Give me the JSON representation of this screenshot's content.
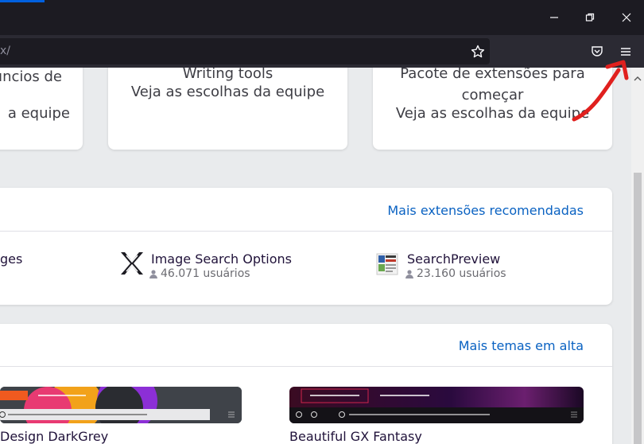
{
  "browser": {
    "url_fragment": "x/",
    "window_buttons": [
      "minimize-icon",
      "restore-icon",
      "close-icon"
    ]
  },
  "categories": {
    "card1": {
      "title": "úncios de",
      "link": "a equipe"
    },
    "card2": {
      "title": "Writing tools",
      "link": "Veja as escolhas da equipe"
    },
    "card3": {
      "title_line1": "Pacote de extensões para",
      "title_line2": "começar",
      "link": "Veja as escolhas da equipe"
    }
  },
  "extensions": {
    "more_link": "Mais extensões recomendadas",
    "items": [
      {
        "name": "ges",
        "users": ""
      },
      {
        "name": "Image Search Options",
        "users": "46.071 usuários"
      },
      {
        "name": "SearchPreview",
        "users": "23.160 usuários"
      }
    ]
  },
  "themes": {
    "more_link": "Mais temas em alta",
    "items": [
      {
        "name": "Design DarkGrey"
      },
      {
        "name": "Beautiful GX Fantasy"
      }
    ]
  },
  "colors": {
    "link": "#0a62c2",
    "annotation_arrow": "#e0201e"
  }
}
